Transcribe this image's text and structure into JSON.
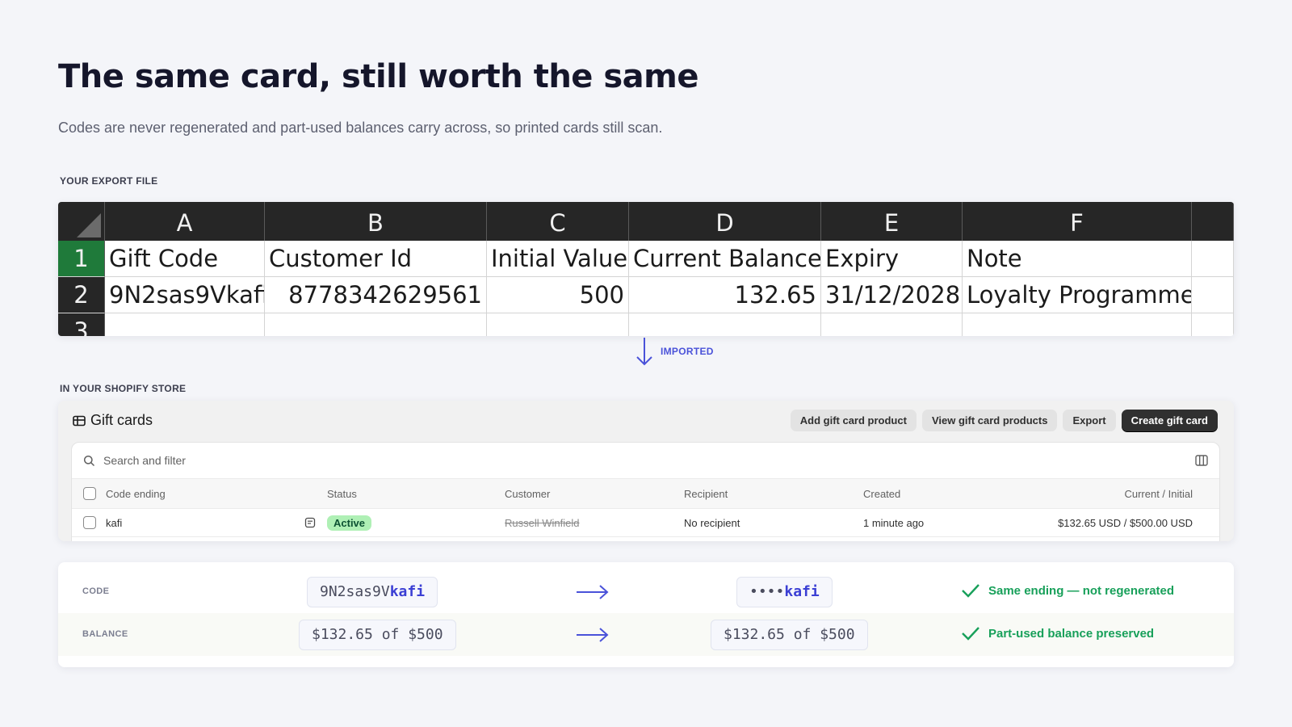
{
  "heading": "The same card, still worth the same",
  "subtitle": "Codes are never regenerated and part-used balances carry across, so printed cards still scan.",
  "export_label": "YOUR EXPORT FILE",
  "store_label": "IN YOUR SHOPIFY STORE",
  "imported_label": "IMPORTED",
  "spreadsheet": {
    "columns": [
      "A",
      "B",
      "C",
      "D",
      "E",
      "F"
    ],
    "row_numbers": [
      "1",
      "2",
      "3"
    ],
    "headers": [
      "Gift Code",
      "Customer Id",
      "Initial Value",
      "Current Balance",
      "Expiry",
      "Note"
    ],
    "row": [
      "9N2sas9Vkafi",
      "8778342629561",
      "500",
      "132.65",
      "31/12/2028",
      "Loyalty Programme"
    ]
  },
  "shopify": {
    "title": "Gift cards",
    "buttons": {
      "add_product": "Add gift card product",
      "view_products": "View gift card products",
      "export": "Export",
      "create": "Create gift card"
    },
    "search_placeholder": "Search and filter",
    "columns": {
      "code": "Code ending",
      "status": "Status",
      "customer": "Customer",
      "recipient": "Recipient",
      "created": "Created",
      "balance": "Current / Initial"
    },
    "row": {
      "code": "kafi",
      "status": "Active",
      "customer": "Russell Winfield",
      "recipient": "No recipient",
      "created": "1 minute ago",
      "balance": "$132.65 USD / $500.00 USD"
    }
  },
  "comparison": {
    "code": {
      "label": "CODE",
      "source_prefix": "9N2sas9V",
      "source_suffix": "kafi",
      "target_mask": "••••",
      "target_suffix": "kafi",
      "result": "Same ending — not regenerated"
    },
    "balance": {
      "label": "BALANCE",
      "source": "$132.65 of $500",
      "target": "$132.65 of $500",
      "result": "Part-used balance preserved"
    }
  },
  "colors": {
    "accent": "#4a52d9",
    "success": "#18a05a",
    "sheet_header": "#262626",
    "sheet_selected_row": "#1f7a3a",
    "badge_bg": "#aff0b5"
  }
}
